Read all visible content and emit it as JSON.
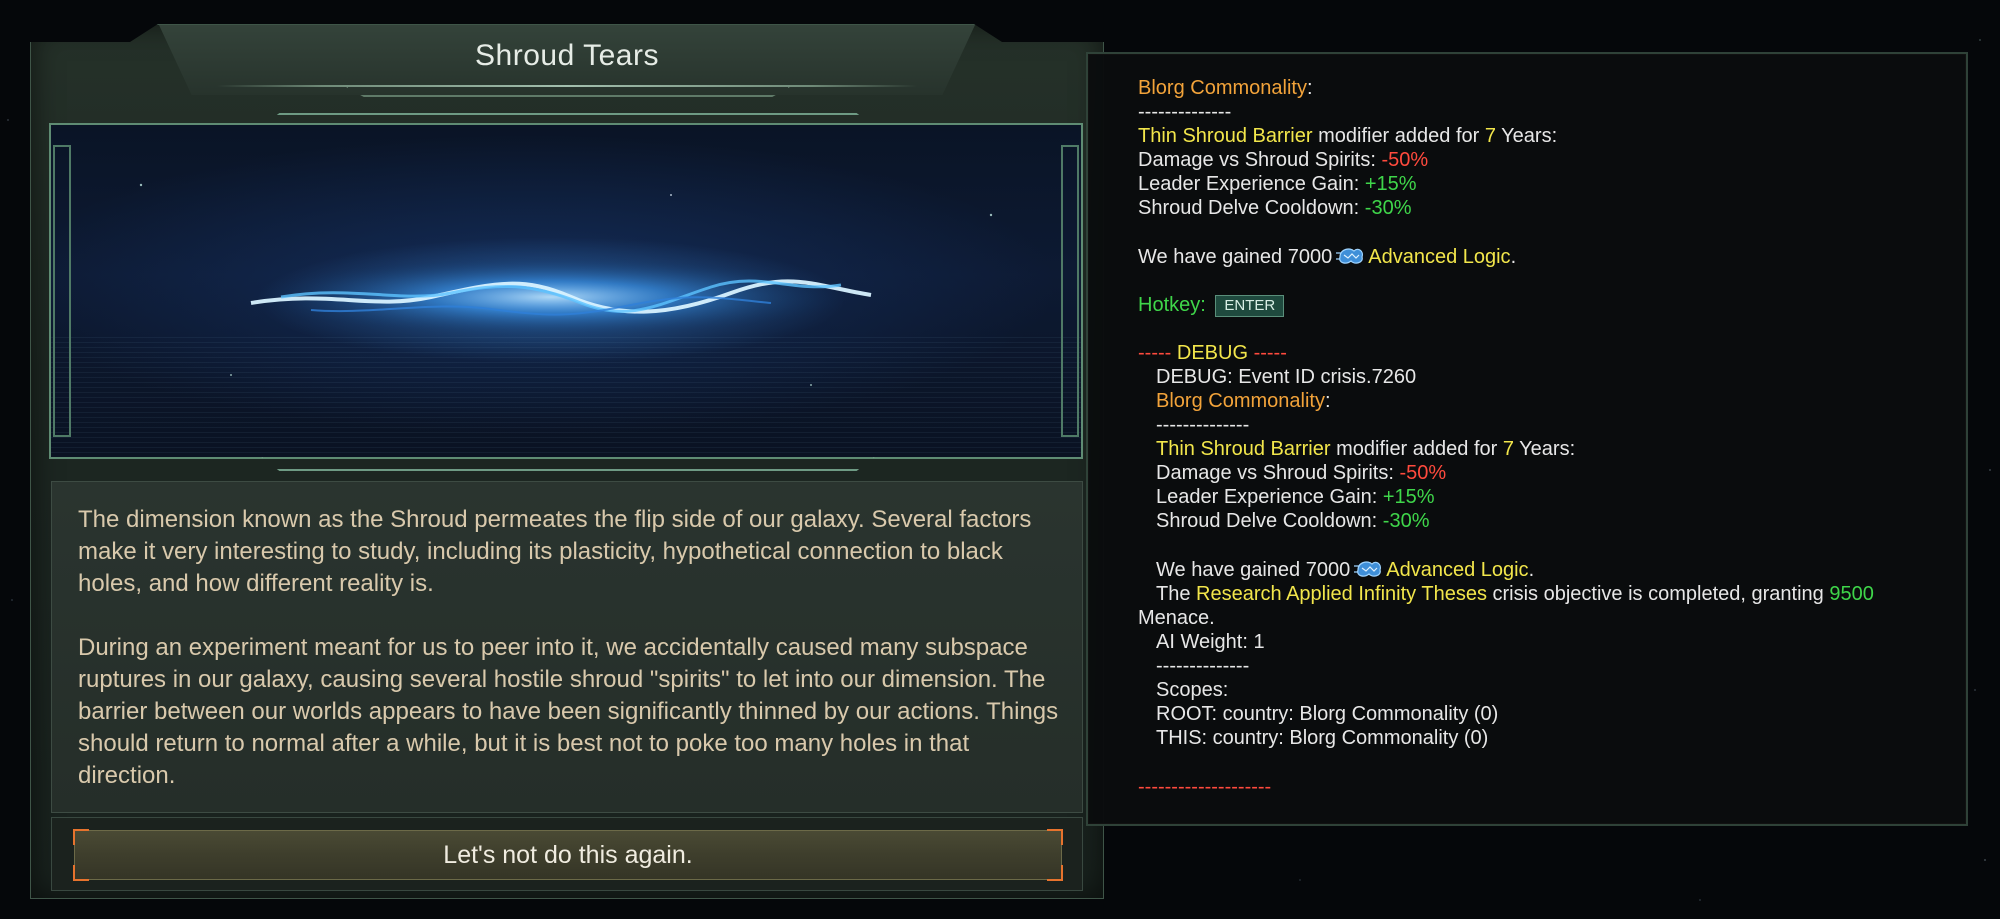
{
  "event": {
    "title": "Shroud Tears",
    "description_p1": "The dimension known as the Shroud permeates the flip side of our galaxy. Several factors make it very interesting to study, including its plasticity, hypothetical connection to black holes, and how different reality is.",
    "description_p2": "During an experiment meant for us to peer into it, we accidentally caused many subspace ruptures in our galaxy, causing several hostile shroud \"spirits\" to let into our dimension. The barrier between our worlds appears to have been significantly thinned by our actions. Things should return to normal after a while, but it is best not to poke too many holes in that direction.",
    "option_label": "Let's not do this again."
  },
  "tooltip": {
    "empire": "Blorg Commonality",
    "colon": ":",
    "separator": "--------------",
    "modifier_name": "Thin Shroud Barrier",
    "modifier_added_for": " modifier added for ",
    "modifier_years": "7",
    "years_suffix": " Years:",
    "effects": [
      {
        "label": "Damage vs Shroud Spirits: ",
        "value": "-50%"
      },
      {
        "label": "Leader Experience Gain: ",
        "value": "+15%"
      },
      {
        "label": "Shroud Delve Cooldown: ",
        "value": "-30%"
      }
    ],
    "gained_prefix": "We have gained 7000",
    "resource": "Advanced Logic",
    "period": ".",
    "hotkey_label": "Hotkey:",
    "hotkey_key": "ENTER",
    "debug_dashes": "-----",
    "debug_title": "DEBUG",
    "debug_event_id": "DEBUG: Event ID crisis.7260",
    "objective_the": "The ",
    "objective_name": "Research Applied Infinity Theses",
    "objective_mid": " crisis objective is completed, granting ",
    "objective_amount": "9500",
    "objective_end": "Menace.",
    "ai_weight": "AI Weight: 1",
    "scopes_label": "Scopes:",
    "scope_root": "ROOT: country: Blorg Commonality (0)",
    "scope_this": "THIS: country: Blorg Commonality (0)",
    "end_line": "--------------------",
    "colors": {
      "orange": "#f2a33a",
      "yellow": "#f2e64b",
      "red": "#ff4a3d",
      "green": "#3fd64a"
    }
  }
}
